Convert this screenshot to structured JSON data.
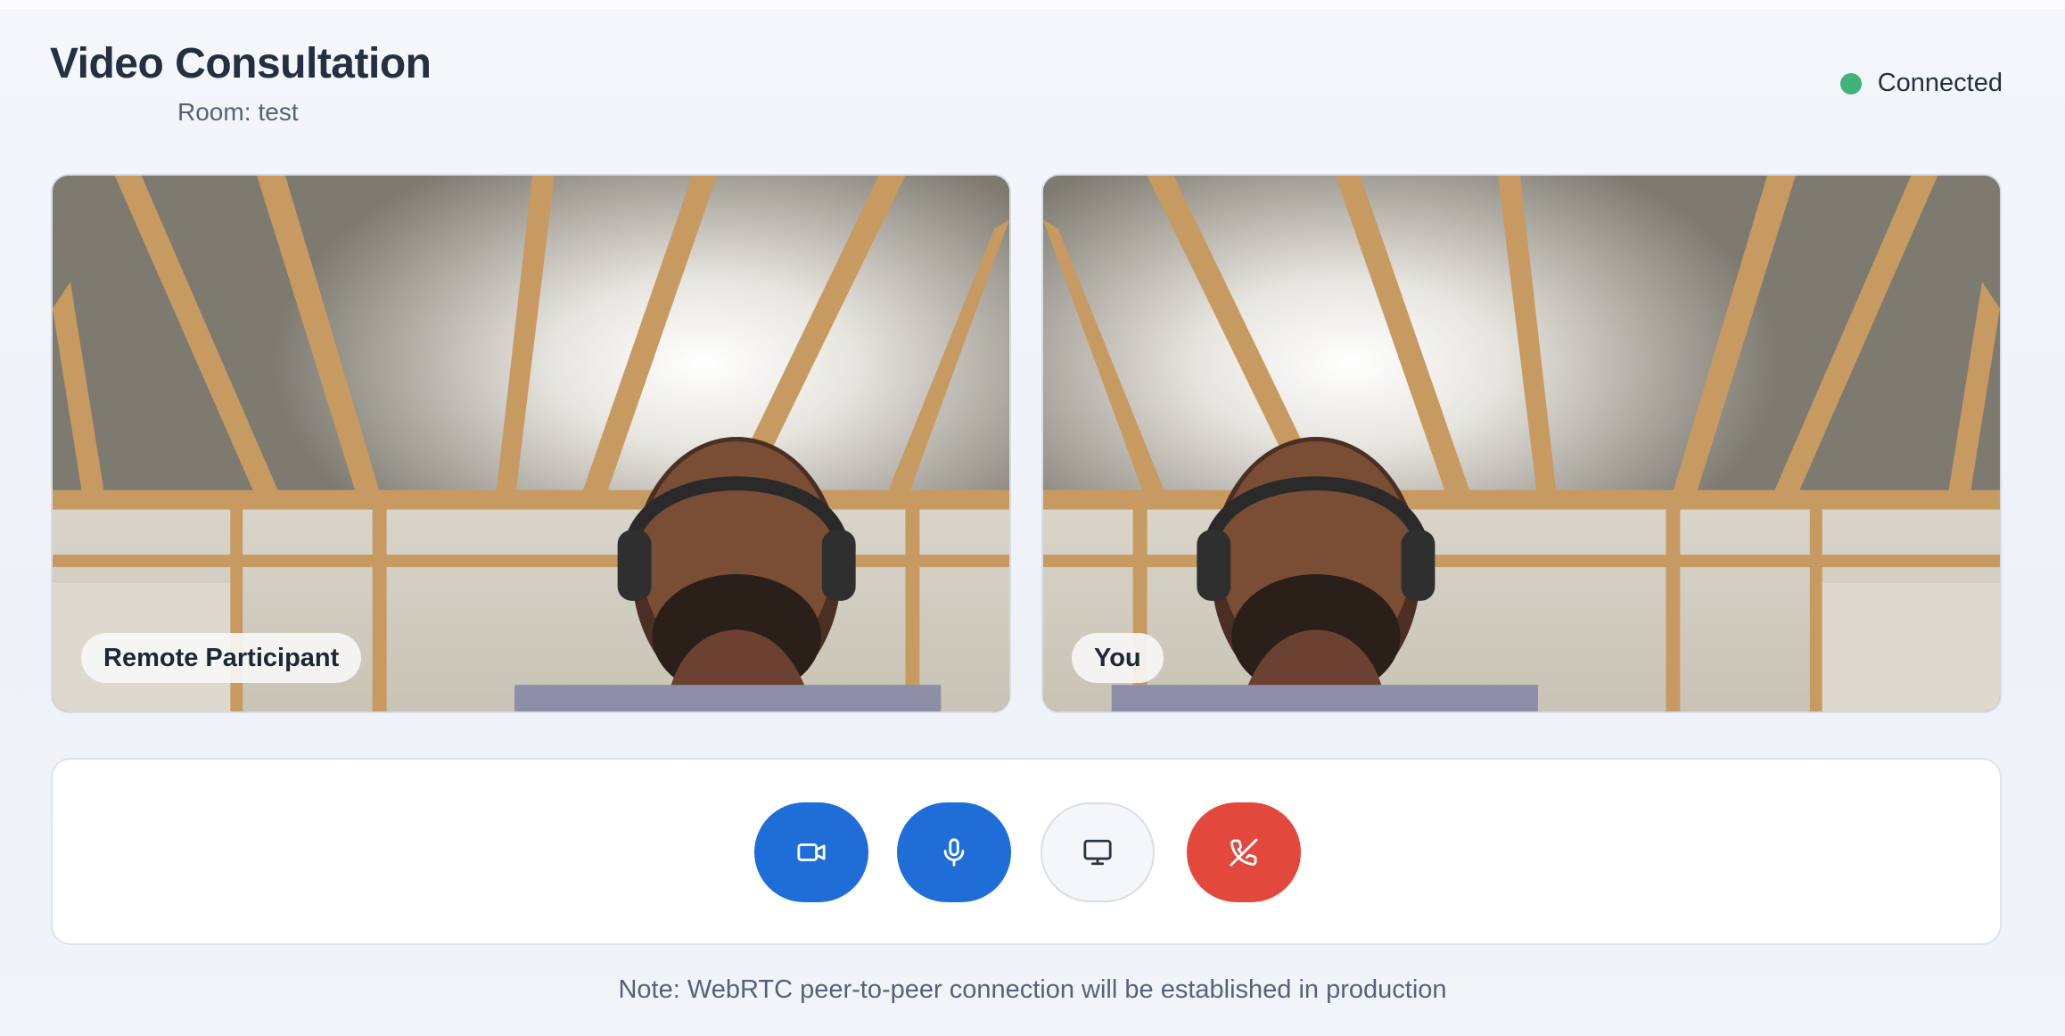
{
  "header": {
    "title": "Video Consultation",
    "room_label": "Room:",
    "room_name": "test",
    "status_text": "Connected",
    "status_color": "#3fb37b"
  },
  "videos": {
    "remote_label": "Remote Participant",
    "local_label": "You"
  },
  "controls": {
    "buttons": [
      {
        "icon": "video-camera-icon",
        "color": "#1f6ed8"
      },
      {
        "icon": "microphone-icon",
        "color": "#1f6ed8"
      },
      {
        "icon": "monitor-icon",
        "color": "#f4f6f9"
      },
      {
        "icon": "phone-off-icon",
        "color": "#e2483c"
      }
    ]
  },
  "note": "Note: WebRTC peer-to-peer connection will be established in production"
}
